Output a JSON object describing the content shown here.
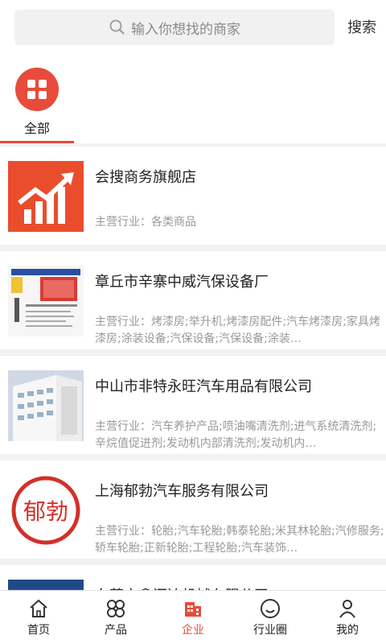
{
  "search": {
    "placeholder": "输入你想找的商家",
    "button": "搜索"
  },
  "categories": [
    {
      "label": "全部",
      "icon": "grid-icon",
      "active": true
    }
  ],
  "companies": [
    {
      "name": "会搜商务旗舰店",
      "desc": "主营行业：各类商品",
      "thumb": "chart-logo"
    },
    {
      "name": "章丘市辛寨中威汽保设备厂",
      "desc": "主营行业：烤漆房;举升机;烤漆房配件;汽车烤漆房;家具烤漆房;涂装设备;汽保设备;汽保设备;涂装…",
      "thumb": "spray-booth-photo"
    },
    {
      "name": "中山市非特永旺汽车用品有限公司",
      "desc": "主营行业：汽车养护产品;喷油嘴清洗剂;进气系统清洗剂;辛烷值促进剂;发动机内部清洗剂;发动机内…",
      "thumb": "building-photo"
    },
    {
      "name": "上海郁勃汽车服务有限公司",
      "desc": "主营行业：轮胎;汽车轮胎;韩泰轮胎;米其林轮胎;汽修服务;轿车轮胎;正新轮胎;工程轮胎;汽车装饰…",
      "thumb": "seal-logo",
      "seal_text": "郁勃"
    },
    {
      "name": "东莞市鑫汇达机械有限公司",
      "desc": "",
      "thumb": "blue-photo"
    }
  ],
  "tabs": [
    {
      "label": "首页",
      "icon": "home-icon"
    },
    {
      "label": "产品",
      "icon": "product-icon"
    },
    {
      "label": "企业",
      "icon": "company-icon",
      "active": true
    },
    {
      "label": "行业圈",
      "icon": "smile-icon"
    },
    {
      "label": "我的",
      "icon": "user-icon"
    }
  ],
  "colors": {
    "accent": "#e84b3c",
    "background": "#f2f2f2"
  }
}
